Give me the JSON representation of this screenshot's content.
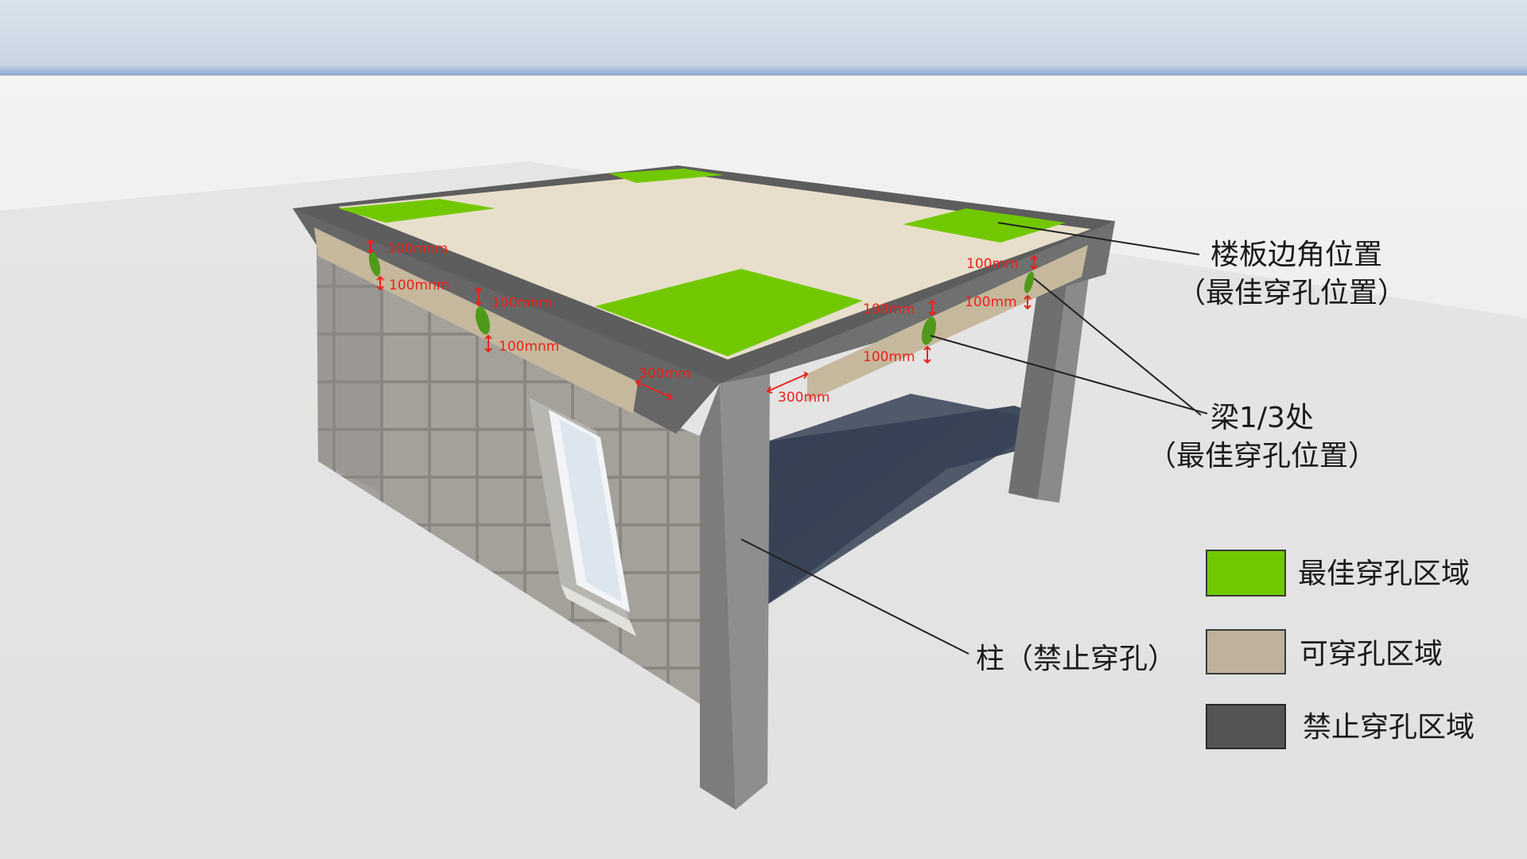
{
  "colors": {
    "optimal": "#72c800",
    "allowed": "#beb29c",
    "forbidden": "#555555",
    "dimension": "#e8231c",
    "slab_surface": "#e7dfcb"
  },
  "callouts": {
    "slab_corner": {
      "line1": "楼板边角位置",
      "line2": "（最佳穿孔位置）"
    },
    "beam_third": {
      "line1": "梁1/3处",
      "line2": "（最佳穿孔位置）"
    },
    "column": {
      "line1": "柱（禁止穿孔）"
    }
  },
  "dimensions": {
    "d1": "100mnm",
    "d2": "100mnm",
    "d3": "100mnm",
    "d4": "100mnm",
    "d5": "300mm",
    "d6": "300mm",
    "d7": "100mm",
    "d8": "100mm",
    "d9": "100mm",
    "d10": "100mm"
  },
  "legend": [
    {
      "key": "optimal",
      "label": "最佳穿孔区域"
    },
    {
      "key": "allowed",
      "label": "可穿孔区域"
    },
    {
      "key": "forbidden",
      "label": "禁止穿孔区域"
    }
  ]
}
